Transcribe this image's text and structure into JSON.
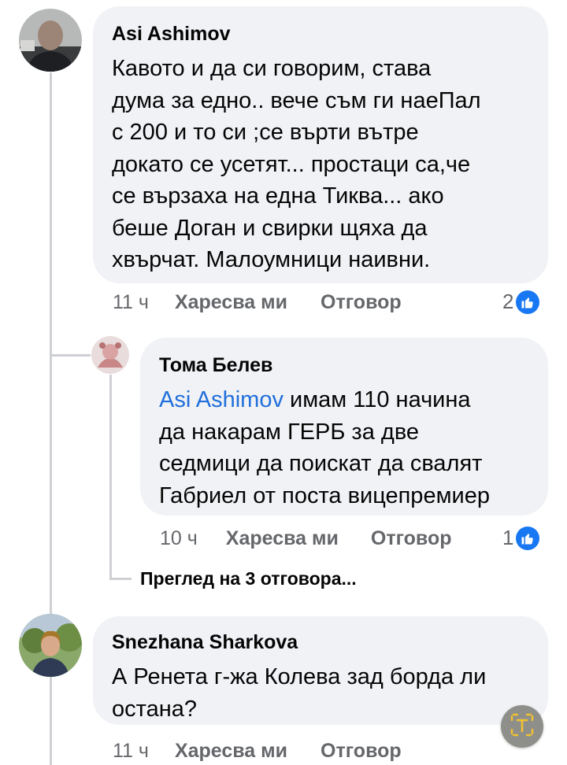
{
  "comments": [
    {
      "author": "Asi Ashimov",
      "text": "Кавото и да си  говорим,  става\nдума за едно..  вече съм ги наеПал\nс 200 и то си ;се върти вътре\nдокато се усетят... простаци са,че\nсе вързаха на една Тиква... ако\nбеше Доган и свирки щяха да\nхвърчат. Малоумници наивни.",
      "time": "11 ч",
      "like_label": "Харесва ми",
      "reply_label": "Отговор",
      "reaction_count": "2"
    },
    {
      "author": "Тома Белев",
      "mention": "Asi Ashimov",
      "text": " имам 110 начина\nда накарам ГЕРБ за две\nседмици да поискат да свалят\nГабриел от поста вицепремиер",
      "time": "10 ч",
      "like_label": "Харесва ми",
      "reply_label": "Отговор",
      "reaction_count": "1"
    },
    {
      "author": "Snezhana Sharkova",
      "text": "А Ренета г-жа Колева зад борда ли\nостана?",
      "time": "11 ч",
      "like_label": "Харесва ми",
      "reply_label": "Отговор"
    }
  ],
  "view_replies_label": "Преглед на 3 отговора...",
  "colors": {
    "bubble": "#f0f2f5",
    "meta_text": "#65676b",
    "mention": "#216fdb",
    "like_blue": "#1877f2",
    "thread_line": "#ced0d4"
  },
  "icons": {
    "like": "thumbs-up-icon",
    "translate": "translate-icon"
  }
}
